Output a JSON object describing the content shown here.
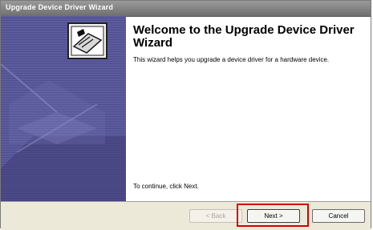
{
  "window": {
    "title": "Upgrade Device Driver Wizard"
  },
  "content": {
    "heading": "Welcome to the Upgrade Device Driver Wizard",
    "description": "This wizard helps you upgrade a device driver for a hardware device.",
    "continue_text": "To continue, click Next."
  },
  "buttons": {
    "back": "< Back",
    "next": "Next >",
    "cancel": "Cancel"
  },
  "icons": {
    "banner_icon": "hardware-card-icon"
  },
  "colors": {
    "banner": "#55548f",
    "highlight": "#d40000",
    "footer": "#ece9d8"
  }
}
